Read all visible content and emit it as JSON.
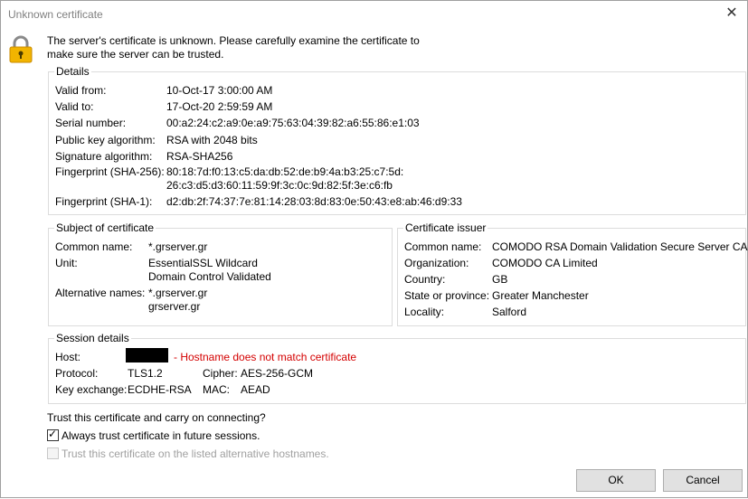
{
  "window": {
    "title": "Unknown certificate",
    "close_glyph": "✕"
  },
  "message": {
    "line1": "The server's certificate is unknown. Please carefully examine the certificate to",
    "line2": "make sure the server can be trusted."
  },
  "details": {
    "label": "Details",
    "rows": [
      {
        "key": "Valid from:",
        "value": "10-Oct-17 3:00:00 AM"
      },
      {
        "key": "Valid to:",
        "value": "17-Oct-20 2:59:59 AM"
      },
      {
        "key": "Serial number:",
        "value": "00:a2:24:c2:a9:0e:a9:75:63:04:39:82:a6:55:86:e1:03"
      },
      {
        "key": "Public key algorithm:",
        "value": "RSA with 2048 bits"
      },
      {
        "key": "Signature algorithm:",
        "value": "RSA-SHA256"
      },
      {
        "key": "Fingerprint (SHA-256):",
        "value": "80:18:7d:f0:13:c5:da:db:52:de:b9:4a:b3:25:c7:5d:",
        "value2": "26:c3:d5:d3:60:11:59:9f:3c:0c:9d:82:5f:3e:c6:fb"
      },
      {
        "key": "Fingerprint (SHA-1):",
        "value": "d2:db:2f:74:37:7e:81:14:28:03:8d:83:0e:50:43:e8:ab:46:d9:33"
      }
    ]
  },
  "subject": {
    "label": "Subject of certificate",
    "common_name_key": "Common name:",
    "common_name": "*.grserver.gr",
    "unit_key": "Unit:",
    "unit_line1": "EssentialSSL Wildcard",
    "unit_line2": "Domain Control Validated",
    "alt_key": "Alternative names:",
    "alt_line1": "*.grserver.gr",
    "alt_line2": "grserver.gr"
  },
  "issuer": {
    "label": "Certificate issuer",
    "rows": [
      {
        "key": "Common name:",
        "value": "COMODO RSA Domain Validation Secure Server CA"
      },
      {
        "key": "Organization:",
        "value": "COMODO CA Limited"
      },
      {
        "key": "Country:",
        "value": "GB"
      },
      {
        "key": "State or province:",
        "value": "Greater Manchester"
      },
      {
        "key": "Locality:",
        "value": "Salford"
      }
    ]
  },
  "session": {
    "label": "Session details",
    "host_key": "Host:",
    "host_warning": "- Hostname does not match certificate",
    "protocol_key": "Protocol:",
    "protocol": "TLS1.2",
    "cipher_key": "Cipher:",
    "cipher": "AES-256-GCM",
    "kex_key": "Key exchange:",
    "kex": "ECDHE-RSA",
    "mac_key": "MAC:",
    "mac": "AEAD"
  },
  "trust": {
    "question": "Trust this certificate and carry on connecting?",
    "always_label": "Always trust certificate in future sessions.",
    "always_checked": true,
    "alt_label": "Trust this certificate on the listed alternative hostnames.",
    "alt_checked": false
  },
  "buttons": {
    "ok": "OK",
    "cancel": "Cancel"
  },
  "colors": {
    "warning": "#d40000",
    "lock_body": "#f2b400",
    "lock_shackle": "#8a8a8a"
  }
}
